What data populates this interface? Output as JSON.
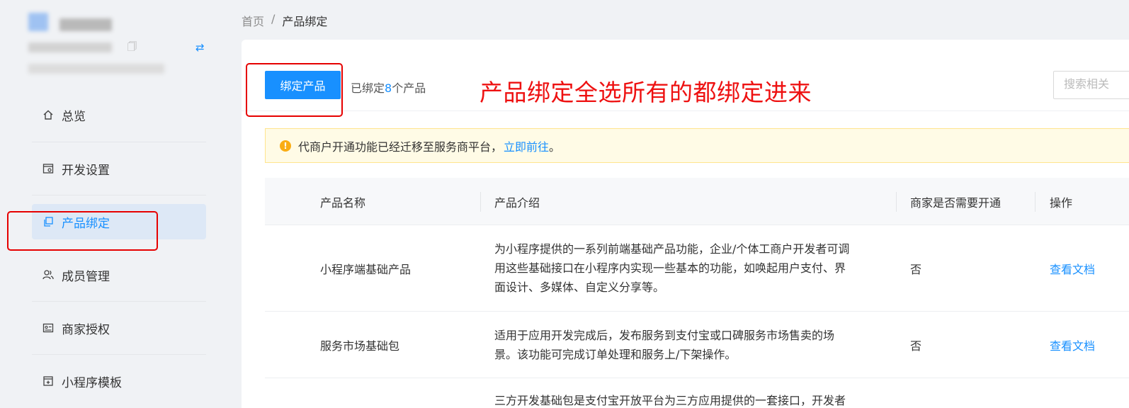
{
  "breadcrumb": {
    "home": "首页",
    "separator": "/",
    "current": "产品绑定"
  },
  "sidebar": {
    "items": [
      {
        "label": "总览",
        "icon": "home-icon"
      },
      {
        "label": "开发设置",
        "icon": "dev-settings-icon"
      },
      {
        "label": "产品绑定",
        "icon": "product-bind-icon",
        "active": true
      },
      {
        "label": "成员管理",
        "icon": "members-icon"
      },
      {
        "label": "商家授权",
        "icon": "merchant-auth-icon"
      },
      {
        "label": "小程序模板",
        "icon": "template-icon"
      }
    ]
  },
  "toolbar": {
    "bind_button": "绑定产品",
    "bound_prefix": "已绑定",
    "bound_count": "8",
    "bound_suffix": "个产品",
    "search_placeholder": "搜索相关"
  },
  "annotation": "产品绑定全选所有的都绑定进来",
  "alert": {
    "text": "代商户开通功能已经迁移至服务商平台，",
    "link": "立即前往",
    "tail": "。"
  },
  "table": {
    "headers": [
      "产品名称",
      "产品介绍",
      "商家是否需要开通",
      "操作"
    ],
    "rows": [
      {
        "name": "小程序端基础产品",
        "desc_lines": [
          "为小程序提供的一系列前端基础产品功能，企业/个体工商户开发者可调",
          "用这些基础接口在小程序内实现一些基本的功能，如唤起用户支付、界",
          "面设计、多媒体、自定义分享等。"
        ],
        "needs_open": "否",
        "action": "查看文档"
      },
      {
        "name": "服务市场基础包",
        "desc_lines": [
          "适用于应用开发完成后，发布服务到支付宝或口碑服务市场售卖的场",
          "景。该功能可完成订单处理和服务上/下架操作。"
        ],
        "needs_open": "否",
        "action": "查看文档"
      },
      {
        "desc_lines": [
          "三方开发基础包是支付宝开放平台为三方应用提供的一套接口，开发者"
        ]
      }
    ]
  },
  "colors": {
    "accent": "#1890ff",
    "highlight": "#e60000",
    "alert_bg": "#fffbe6"
  }
}
